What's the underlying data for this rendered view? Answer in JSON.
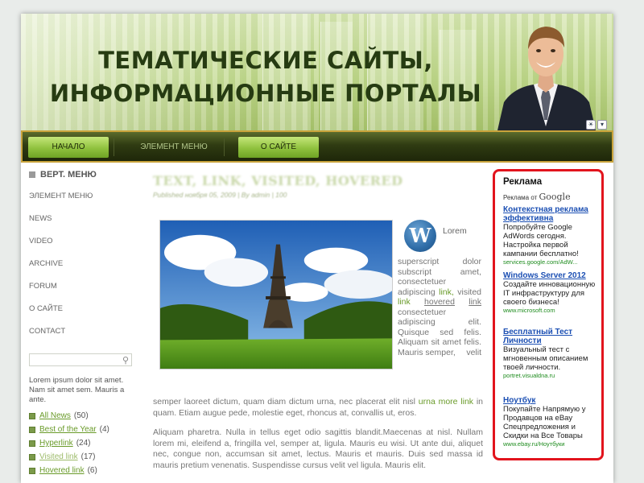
{
  "header": {
    "title_line1": "ТЕМАТИЧЕСКИЕ САЙТЫ,",
    "title_line2": "ИНФОРМАЦИОННЫЕ ПОРТАЛЫ"
  },
  "nav": {
    "items": [
      {
        "label": "НАЧАЛО",
        "active": true
      },
      {
        "label": "ЭЛЕМЕНТ МЕНЮ",
        "active": false
      },
      {
        "label": "О САЙТЕ",
        "active": true
      }
    ]
  },
  "sidebar": {
    "menu_head": "ВЕРТ. МЕНЮ",
    "items": [
      "ЭЛЕМЕНТ МЕНЮ",
      "NEWS",
      "VIDEO",
      "ARCHIVE",
      "FORUM",
      "О САЙТЕ",
      "CONTACT"
    ],
    "text": "Lorem ipsum dolor sit amet. Nam sit amet sem. Mauris a ante.",
    "categories": [
      {
        "label": "All News",
        "count": "(50)"
      },
      {
        "label": "Best of the Year",
        "count": "(4)"
      },
      {
        "label": "Hyperlink",
        "count": "(24)"
      },
      {
        "label": "Visited link",
        "count": "(17)"
      },
      {
        "label": "Hovered link",
        "count": "(6)"
      }
    ]
  },
  "post": {
    "title": "TEXT, LINK, VISITED, HOVERED",
    "meta": "Published ноября 05, 2009 | By admin | 100",
    "lorem": "Lorem",
    "side_text": {
      "superscript": "superscript",
      "dolor": "dolor",
      "subscript": "subscript",
      "amet": "amet,",
      "consectetuer1": "consectetuer",
      "adipiscing1": "adipiscing",
      "link": "link,",
      "visited": "visited",
      "link2": "link",
      "hovered": "hovered",
      "link3": "link",
      "consectetuer2": "consectetuer",
      "adipiscing2": "adipiscing elit.",
      "rest": "Quisque sed felis. Aliquam sit amet felis. Mauris semper,"
    },
    "velit": "velit",
    "para1_a": "semper laoreet dictum, quam diam dictum urna, nec placerat elit nisl",
    "para1_link": "urna more link",
    "para1_b": "in quam. Etiam augue pede, molestie eget, rhoncus at, convallis ut, eros.",
    "para2": "Aliquam pharetra. Nulla in tellus eget odio sagittis blandit.Maecenas at nisl. Nullam lorem mi, eleifend a, fringilla vel, semper at, ligula. Mauris eu wisi. Ut ante dui, aliquet nec, congue non, accumsan sit amet, lectus. Mauris et mauris. Duis sed massa id mauris pretium venenatis. Suspendisse cursus velit vel ligula. Mauris elit."
  },
  "ad": {
    "title": "Реклама",
    "by": "Реклама от",
    "by_brand": "Google",
    "items": [
      {
        "title": "Контекстная реклама эффективна",
        "desc": "Попробуйте Google AdWords сегодня. Настройка первой кампании бесплатно!",
        "url": "services.google.com/AdW..."
      },
      {
        "title": "Windows Server 2012",
        "desc": "Создайте инновационную IT инфраструктуру для своего бизнеса!",
        "url": "www.microsoft.com"
      },
      {
        "title": "Бесплатный Тест Личности",
        "desc": "Визуальный тест с мгновенным описанием твоей личности.",
        "url": "portret.visualdna.ru"
      },
      {
        "title": "Ноутбук",
        "desc": "Покупайте Напрямую у Продавцов на eBay Спецпредложения и Скидки на Все Товары",
        "url": "www.ebay.ru/Ноутбуки"
      }
    ]
  },
  "colors": {
    "accent_green": "#8fc13e",
    "nav_dark": "#2f3b12",
    "ad_border": "#e2141d",
    "link_green": "#6a9b2a",
    "ad_link": "#1b4fb3"
  }
}
